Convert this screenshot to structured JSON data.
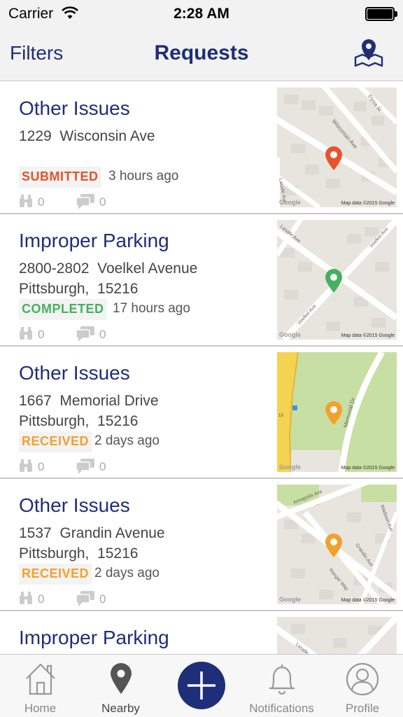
{
  "status_bar": {
    "carrier": "Carrier",
    "time": "2:28 AM"
  },
  "nav": {
    "filters_label": "Filters",
    "title": "Requests",
    "map_icon": "map-pin-icon"
  },
  "requests": [
    {
      "title": "Other Issues",
      "address_line1": "1229  Wisconsin Ave",
      "address_line2": "",
      "status": "SUBMITTED",
      "status_color": "#e8522c",
      "time_ago": "3 hours ago",
      "followers": "0",
      "comments": "0",
      "pin_color": "#e8522c"
    },
    {
      "title": "Improper Parking",
      "address_line1": "2800-2802  Voelkel Avenue",
      "address_line2": "Pittsburgh,  15216",
      "status": "COMPLETED",
      "status_color": "#45b05f",
      "time_ago": "17 hours ago",
      "followers": "0",
      "comments": "0",
      "pin_color": "#45b05f"
    },
    {
      "title": "Other Issues",
      "address_line1": "1667  Memorial Drive",
      "address_line2": "Pittsburgh,  15216",
      "status": "RECEIVED",
      "status_color": "#f2a12d",
      "time_ago": "2 days ago",
      "followers": "0",
      "comments": "0",
      "pin_color": "#f2a12d"
    },
    {
      "title": "Other Issues",
      "address_line1": "1537  Grandin Avenue",
      "address_line2": "Pittsburgh,  15216",
      "status": "RECEIVED",
      "status_color": "#f2a12d",
      "time_ago": "2 days ago",
      "followers": "0",
      "comments": "0",
      "pin_color": "#f2a12d"
    },
    {
      "title": "Improper Parking"
    }
  ],
  "maps": [
    {
      "streets": [
        "Wisconsin Ave",
        "Elysia St",
        "Lasalle Ave"
      ],
      "attribution": "Map data ©2015 Google",
      "watermark": "Google"
    },
    {
      "streets": [
        "Lasalle Ave",
        "Voelkel Ave",
        "Voelkel Ave"
      ],
      "attribution": "Map data ©2015 Google",
      "watermark": "Google"
    },
    {
      "streets": [
        "Memorial Dr"
      ],
      "attribution": "Map data ©2015 Google",
      "watermark": "Google"
    },
    {
      "streets": [
        "Annapolis Ave",
        "Madison Ave",
        "Grandin Ave",
        "Ranger Way"
      ],
      "attribution": "Map data ©2015 Google",
      "watermark": "Google"
    },
    {
      "streets": [
        "Lasalle Ave"
      ]
    }
  ],
  "tabs": [
    {
      "label": "Home",
      "icon": "home-icon"
    },
    {
      "label": "Nearby",
      "icon": "location-pin-icon"
    },
    {
      "label": "",
      "icon": "plus-icon"
    },
    {
      "label": "Notifications",
      "icon": "bell-icon"
    },
    {
      "label": "Profile",
      "icon": "user-icon"
    }
  ],
  "colors": {
    "brand": "#1f2e78",
    "submitted": "#e8522c",
    "completed": "#45b05f",
    "received": "#f2a12d"
  }
}
